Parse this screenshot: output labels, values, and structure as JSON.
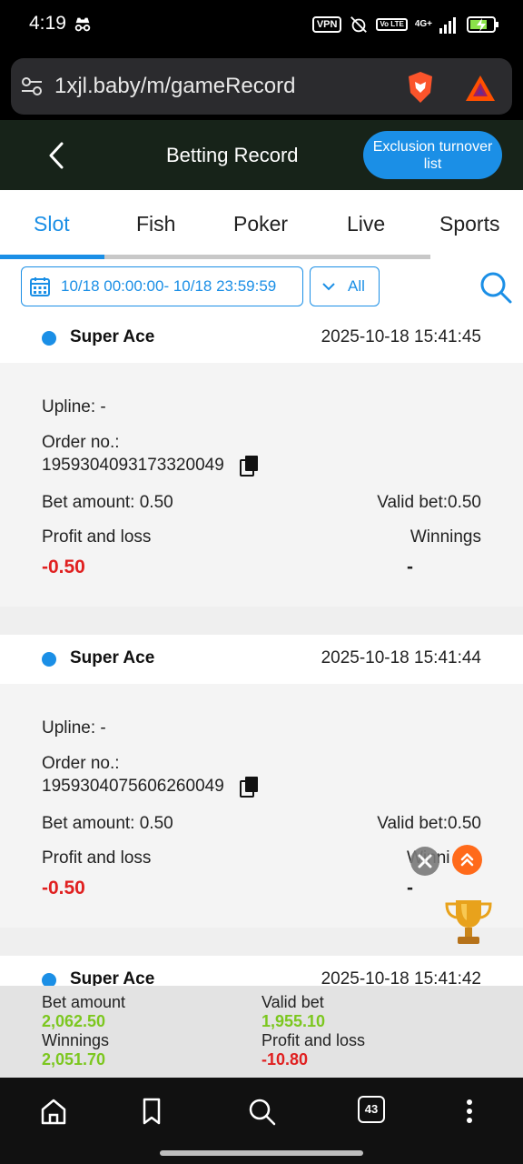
{
  "status_bar": {
    "time": "4:19",
    "vpn": "VPN",
    "volte": "Vo LTE",
    "network": "4G+"
  },
  "browser": {
    "url": "1xjl.baby/m/gameRecord",
    "tab_count": "43"
  },
  "header": {
    "title": "Betting Record",
    "exclusion_button": "Exclusion turnover list"
  },
  "tabs": [
    {
      "label": "Slot",
      "active": true
    },
    {
      "label": "Fish",
      "active": false
    },
    {
      "label": "Poker",
      "active": false
    },
    {
      "label": "Live",
      "active": false
    },
    {
      "label": "Sports",
      "active": false
    }
  ],
  "filters": {
    "date_range": "10/18 00:00:00- 10/18 23:59:59",
    "type": "All"
  },
  "records": [
    {
      "game": "Super Ace",
      "time": "2025-10-18 15:41:45",
      "upline": "Upline: -",
      "order_label": "Order no.:",
      "order_no": "1959304093173320049",
      "bet_amount": "Bet amount: 0.50",
      "valid_bet": "Valid bet:0.50",
      "profit_label": "Profit and loss",
      "winnings_label": "Winnings",
      "profit": "-0.50",
      "winnings": "-"
    },
    {
      "game": "Super Ace",
      "time": "2025-10-18 15:41:44",
      "upline": "Upline: -",
      "order_label": "Order no.:",
      "order_no": "1959304075606260049",
      "bet_amount": "Bet amount: 0.50",
      "valid_bet": "Valid bet:0.50",
      "profit_label": "Profit and loss",
      "winnings_label": "Winni",
      "profit": "-0.50",
      "winnings": "-"
    },
    {
      "game": "Super Ace",
      "time": "2025-10-18 15:41:42"
    }
  ],
  "summary": {
    "bet_amount_label": "Bet amount",
    "bet_amount": "2,062.50",
    "valid_bet_label": "Valid bet",
    "valid_bet": "1,955.10",
    "winnings_label": "Winnings",
    "winnings": "2,051.70",
    "profit_label": "Profit and loss",
    "profit": "-10.80"
  },
  "colors": {
    "accent": "#1b8fe6",
    "loss": "#e02020",
    "gain": "#7cc71f",
    "header_bg": "#172319"
  }
}
